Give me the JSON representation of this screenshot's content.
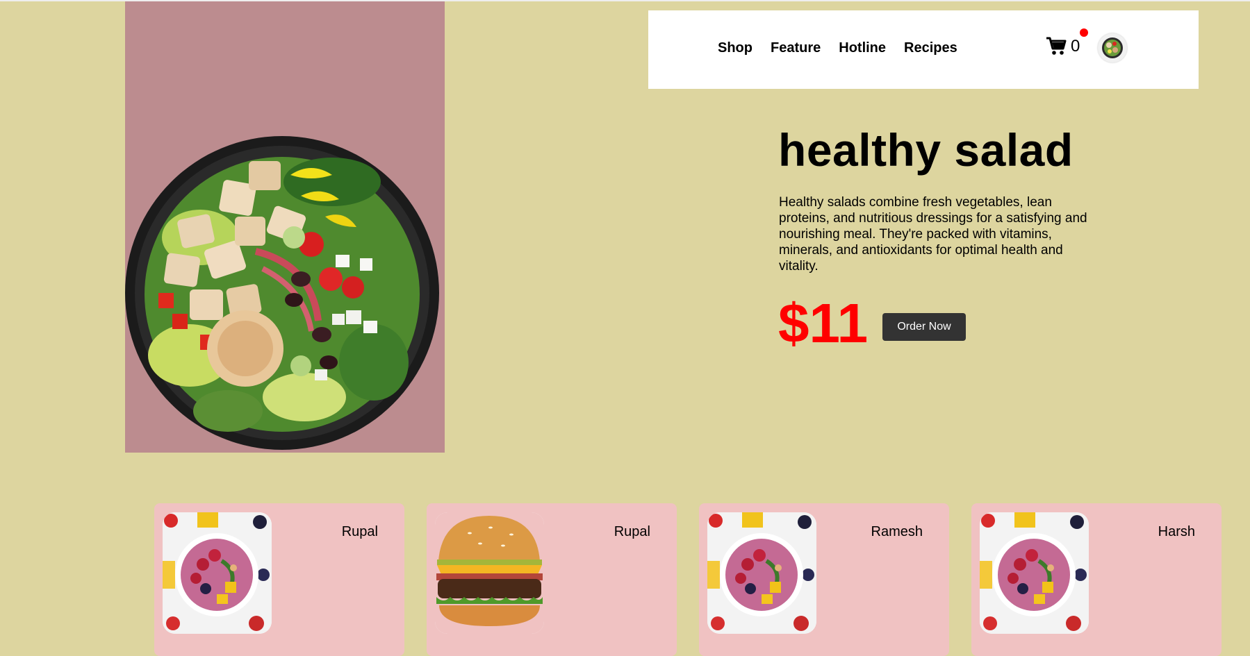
{
  "nav": {
    "links": [
      "Shop",
      "Feature",
      "Hotline",
      "Recipes"
    ],
    "cart_count": "0"
  },
  "hero": {
    "title": "healthy salad",
    "description": "Healthy salads combine fresh vegetables, lean proteins, and nutritious dressings for a satisfying and nourishing meal. They're packed with vitamins, minerals, and antioxidants for optimal health and vitality.",
    "price": "$11",
    "order_button": "Order Now"
  },
  "cards": [
    {
      "name": "Rupal",
      "image": "smoothie-bowl"
    },
    {
      "name": "Rupal",
      "image": "burger"
    },
    {
      "name": "Ramesh",
      "image": "smoothie-bowl"
    },
    {
      "name": "Harsh",
      "image": "smoothie-bowl"
    }
  ],
  "colors": {
    "background": "#ddd59f",
    "hero_panel": "#bc8c8f",
    "card": "#f0c2c2",
    "price": "#ff0000",
    "button": "#333333"
  },
  "icons": [
    "shopping-cart-icon",
    "notification-dot",
    "user-avatar"
  ]
}
